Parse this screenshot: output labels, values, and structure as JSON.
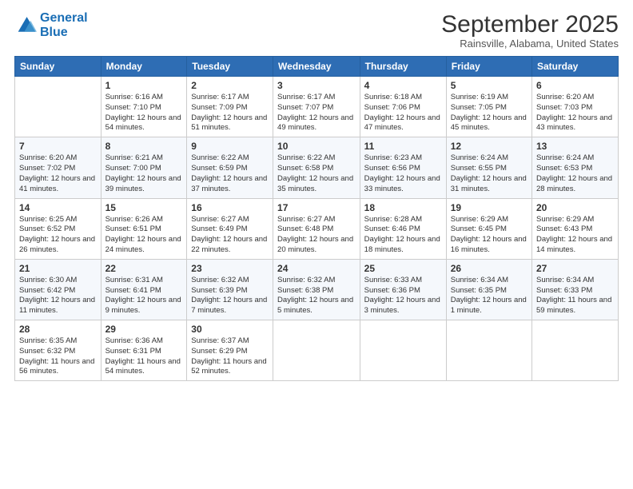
{
  "logo": {
    "line1": "General",
    "line2": "Blue"
  },
  "header": {
    "month": "September 2025",
    "location": "Rainsville, Alabama, United States"
  },
  "weekdays": [
    "Sunday",
    "Monday",
    "Tuesday",
    "Wednesday",
    "Thursday",
    "Friday",
    "Saturday"
  ],
  "weeks": [
    [
      {
        "day": "",
        "sunrise": "",
        "sunset": "",
        "daylight": ""
      },
      {
        "day": "1",
        "sunrise": "Sunrise: 6:16 AM",
        "sunset": "Sunset: 7:10 PM",
        "daylight": "Daylight: 12 hours and 54 minutes."
      },
      {
        "day": "2",
        "sunrise": "Sunrise: 6:17 AM",
        "sunset": "Sunset: 7:09 PM",
        "daylight": "Daylight: 12 hours and 51 minutes."
      },
      {
        "day": "3",
        "sunrise": "Sunrise: 6:17 AM",
        "sunset": "Sunset: 7:07 PM",
        "daylight": "Daylight: 12 hours and 49 minutes."
      },
      {
        "day": "4",
        "sunrise": "Sunrise: 6:18 AM",
        "sunset": "Sunset: 7:06 PM",
        "daylight": "Daylight: 12 hours and 47 minutes."
      },
      {
        "day": "5",
        "sunrise": "Sunrise: 6:19 AM",
        "sunset": "Sunset: 7:05 PM",
        "daylight": "Daylight: 12 hours and 45 minutes."
      },
      {
        "day": "6",
        "sunrise": "Sunrise: 6:20 AM",
        "sunset": "Sunset: 7:03 PM",
        "daylight": "Daylight: 12 hours and 43 minutes."
      }
    ],
    [
      {
        "day": "7",
        "sunrise": "Sunrise: 6:20 AM",
        "sunset": "Sunset: 7:02 PM",
        "daylight": "Daylight: 12 hours and 41 minutes."
      },
      {
        "day": "8",
        "sunrise": "Sunrise: 6:21 AM",
        "sunset": "Sunset: 7:00 PM",
        "daylight": "Daylight: 12 hours and 39 minutes."
      },
      {
        "day": "9",
        "sunrise": "Sunrise: 6:22 AM",
        "sunset": "Sunset: 6:59 PM",
        "daylight": "Daylight: 12 hours and 37 minutes."
      },
      {
        "day": "10",
        "sunrise": "Sunrise: 6:22 AM",
        "sunset": "Sunset: 6:58 PM",
        "daylight": "Daylight: 12 hours and 35 minutes."
      },
      {
        "day": "11",
        "sunrise": "Sunrise: 6:23 AM",
        "sunset": "Sunset: 6:56 PM",
        "daylight": "Daylight: 12 hours and 33 minutes."
      },
      {
        "day": "12",
        "sunrise": "Sunrise: 6:24 AM",
        "sunset": "Sunset: 6:55 PM",
        "daylight": "Daylight: 12 hours and 31 minutes."
      },
      {
        "day": "13",
        "sunrise": "Sunrise: 6:24 AM",
        "sunset": "Sunset: 6:53 PM",
        "daylight": "Daylight: 12 hours and 28 minutes."
      }
    ],
    [
      {
        "day": "14",
        "sunrise": "Sunrise: 6:25 AM",
        "sunset": "Sunset: 6:52 PM",
        "daylight": "Daylight: 12 hours and 26 minutes."
      },
      {
        "day": "15",
        "sunrise": "Sunrise: 6:26 AM",
        "sunset": "Sunset: 6:51 PM",
        "daylight": "Daylight: 12 hours and 24 minutes."
      },
      {
        "day": "16",
        "sunrise": "Sunrise: 6:27 AM",
        "sunset": "Sunset: 6:49 PM",
        "daylight": "Daylight: 12 hours and 22 minutes."
      },
      {
        "day": "17",
        "sunrise": "Sunrise: 6:27 AM",
        "sunset": "Sunset: 6:48 PM",
        "daylight": "Daylight: 12 hours and 20 minutes."
      },
      {
        "day": "18",
        "sunrise": "Sunrise: 6:28 AM",
        "sunset": "Sunset: 6:46 PM",
        "daylight": "Daylight: 12 hours and 18 minutes."
      },
      {
        "day": "19",
        "sunrise": "Sunrise: 6:29 AM",
        "sunset": "Sunset: 6:45 PM",
        "daylight": "Daylight: 12 hours and 16 minutes."
      },
      {
        "day": "20",
        "sunrise": "Sunrise: 6:29 AM",
        "sunset": "Sunset: 6:43 PM",
        "daylight": "Daylight: 12 hours and 14 minutes."
      }
    ],
    [
      {
        "day": "21",
        "sunrise": "Sunrise: 6:30 AM",
        "sunset": "Sunset: 6:42 PM",
        "daylight": "Daylight: 12 hours and 11 minutes."
      },
      {
        "day": "22",
        "sunrise": "Sunrise: 6:31 AM",
        "sunset": "Sunset: 6:41 PM",
        "daylight": "Daylight: 12 hours and 9 minutes."
      },
      {
        "day": "23",
        "sunrise": "Sunrise: 6:32 AM",
        "sunset": "Sunset: 6:39 PM",
        "daylight": "Daylight: 12 hours and 7 minutes."
      },
      {
        "day": "24",
        "sunrise": "Sunrise: 6:32 AM",
        "sunset": "Sunset: 6:38 PM",
        "daylight": "Daylight: 12 hours and 5 minutes."
      },
      {
        "day": "25",
        "sunrise": "Sunrise: 6:33 AM",
        "sunset": "Sunset: 6:36 PM",
        "daylight": "Daylight: 12 hours and 3 minutes."
      },
      {
        "day": "26",
        "sunrise": "Sunrise: 6:34 AM",
        "sunset": "Sunset: 6:35 PM",
        "daylight": "Daylight: 12 hours and 1 minute."
      },
      {
        "day": "27",
        "sunrise": "Sunrise: 6:34 AM",
        "sunset": "Sunset: 6:33 PM",
        "daylight": "Daylight: 11 hours and 59 minutes."
      }
    ],
    [
      {
        "day": "28",
        "sunrise": "Sunrise: 6:35 AM",
        "sunset": "Sunset: 6:32 PM",
        "daylight": "Daylight: 11 hours and 56 minutes."
      },
      {
        "day": "29",
        "sunrise": "Sunrise: 6:36 AM",
        "sunset": "Sunset: 6:31 PM",
        "daylight": "Daylight: 11 hours and 54 minutes."
      },
      {
        "day": "30",
        "sunrise": "Sunrise: 6:37 AM",
        "sunset": "Sunset: 6:29 PM",
        "daylight": "Daylight: 11 hours and 52 minutes."
      },
      {
        "day": "",
        "sunrise": "",
        "sunset": "",
        "daylight": ""
      },
      {
        "day": "",
        "sunrise": "",
        "sunset": "",
        "daylight": ""
      },
      {
        "day": "",
        "sunrise": "",
        "sunset": "",
        "daylight": ""
      },
      {
        "day": "",
        "sunrise": "",
        "sunset": "",
        "daylight": ""
      }
    ]
  ]
}
